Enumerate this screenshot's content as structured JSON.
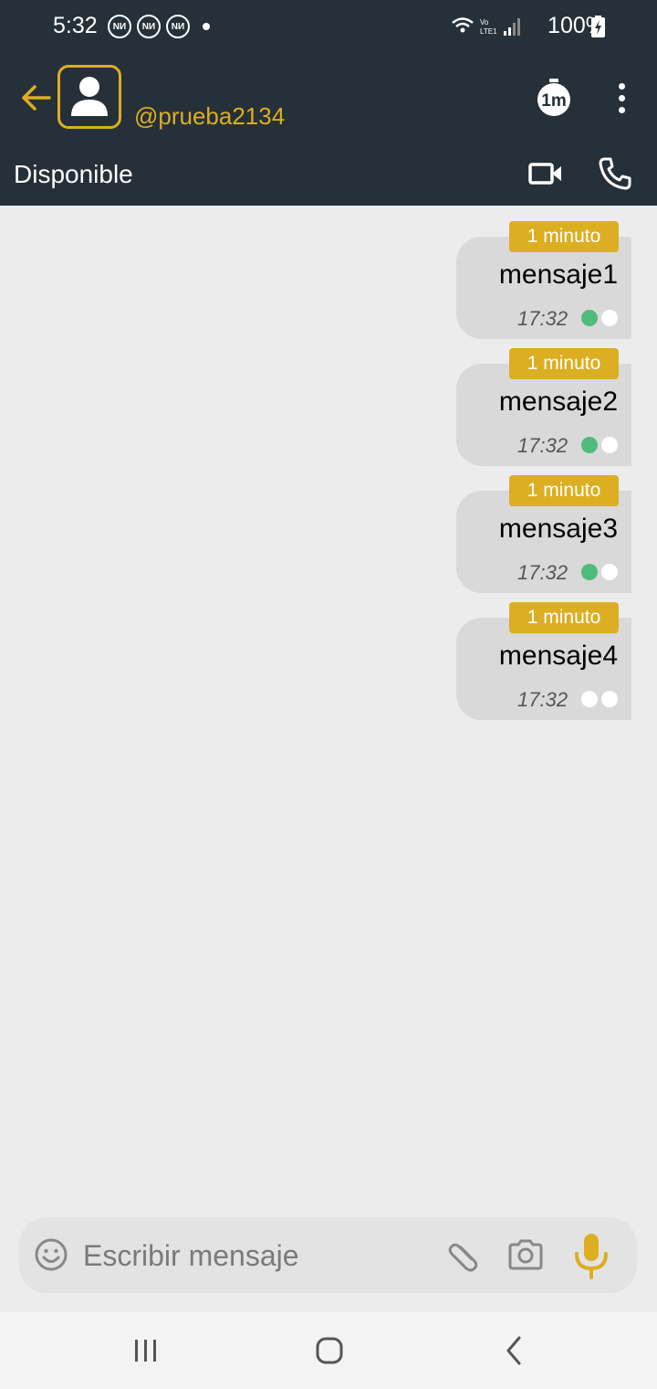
{
  "status_bar": {
    "time": "5:32",
    "notification_badge": "NИ",
    "battery": "100%"
  },
  "header": {
    "username": "@prueba2134",
    "presence": "Disponible",
    "timer_icon_text": "1m",
    "accent_color": "#dcae22",
    "bar_color": "#263038"
  },
  "messages": [
    {
      "ttl": "1 minuto",
      "text": "mensaje1",
      "time": "17:32",
      "delivered": true,
      "read": false
    },
    {
      "ttl": "1 minuto",
      "text": "mensaje2",
      "time": "17:32",
      "delivered": true,
      "read": false
    },
    {
      "ttl": "1 minuto",
      "text": "mensaje3",
      "time": "17:32",
      "delivered": true,
      "read": false
    },
    {
      "ttl": "1 minuto",
      "text": "mensaje4",
      "time": "17:32",
      "delivered": false,
      "read": false
    }
  ],
  "composer": {
    "placeholder": "Escribir mensaje"
  },
  "icons": {
    "back": "arrow-left-icon",
    "avatar": "user-icon",
    "timer": "timer-icon",
    "menu": "more-vert-icon",
    "video": "video-camera-icon",
    "call": "phone-icon",
    "emoji": "emoji-icon",
    "attach": "paperclip-icon",
    "camera": "camera-icon",
    "mic": "microphone-icon"
  },
  "tick_colors": {
    "on": "#4fba7c",
    "off": "#ffffff"
  }
}
